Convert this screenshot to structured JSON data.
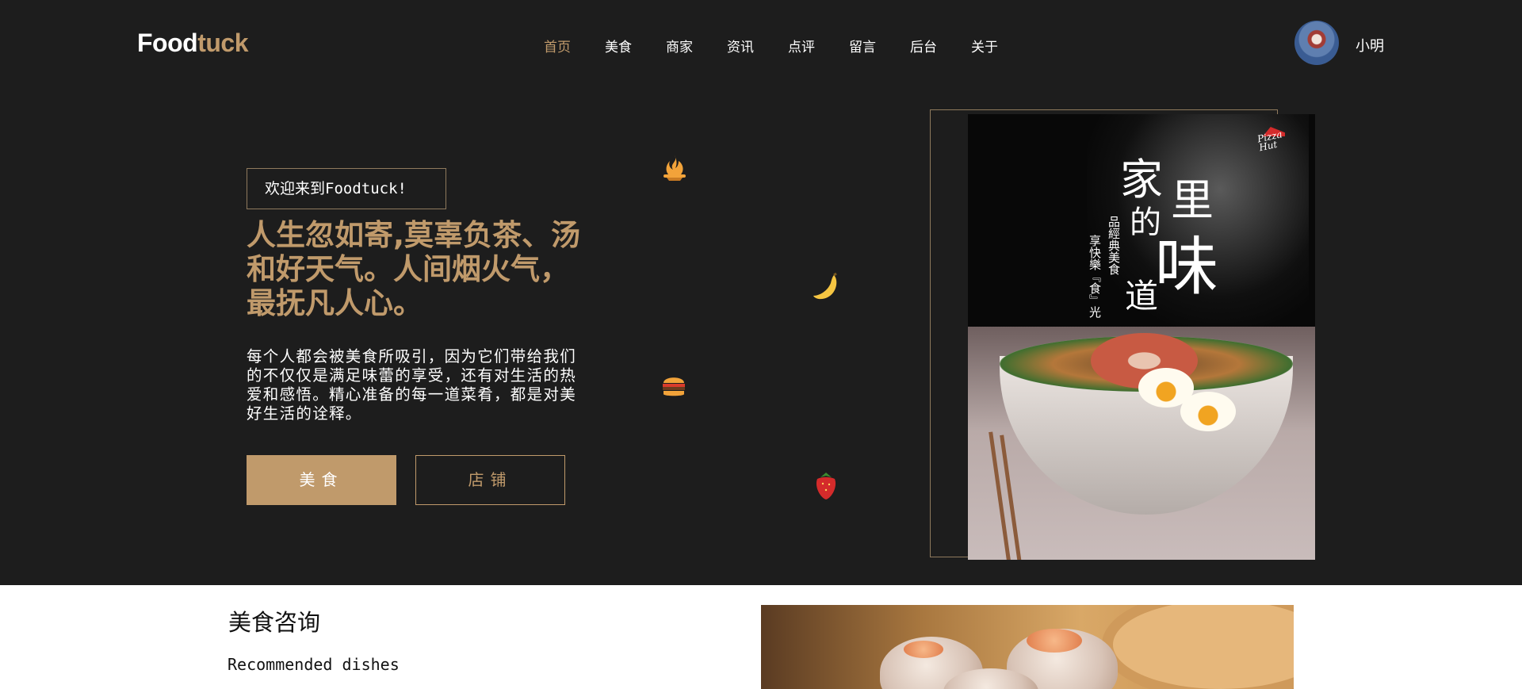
{
  "header": {
    "logo_part1": "Food",
    "logo_part2": "tuck",
    "nav": [
      "首页",
      "美食",
      "商家",
      "资讯",
      "点评",
      "留言",
      "后台",
      "关于"
    ],
    "active_nav": "首页",
    "username": "小明"
  },
  "hero": {
    "welcome": "欢迎来到Foodtuck!",
    "headline": "人生忽如寄,莫辜负茶、汤和好天气。人间烟火气，最抚凡人心。",
    "description": "每个人都会被美食所吸引，因为它们带给我们的不仅仅是满足味蕾的享受，还有对生活的热爱和感悟。精心准备的每一道菜肴，都是对美好生活的诠释。",
    "button_food": "美食",
    "button_shop": "店铺",
    "food_icons": [
      "flame-dish-icon",
      "banana-icon",
      "burger-icon",
      "strawberry-icon"
    ]
  },
  "poster": {
    "brand": "Pizza Hut",
    "title_chars": [
      "家",
      "里",
      "的",
      "味",
      "道"
    ],
    "subtitle_col1": "品經典美食",
    "subtitle_col2": "享快樂『食』光"
  },
  "section": {
    "title": "美食咨询",
    "subtitle": "Recommended dishes"
  },
  "colors": {
    "accent": "#c09a6b",
    "hero_bg": "#1d1d1d",
    "text_light": "#ffffff"
  }
}
